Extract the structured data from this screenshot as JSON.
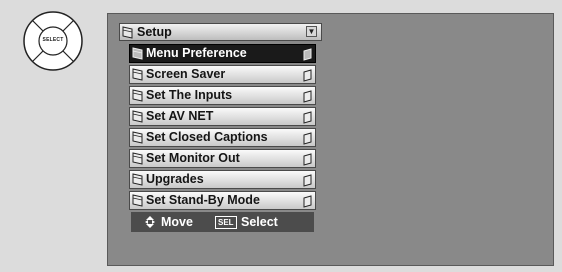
{
  "remote": {
    "center_label": "SELECT"
  },
  "menu": {
    "title": "Setup",
    "items": [
      {
        "label": "Menu Preference",
        "selected": true
      },
      {
        "label": "Screen Saver",
        "selected": false
      },
      {
        "label": "Set The Inputs",
        "selected": false
      },
      {
        "label": "Set AV NET",
        "selected": false
      },
      {
        "label": "Set Closed Captions",
        "selected": false
      },
      {
        "label": "Set Monitor Out",
        "selected": false
      },
      {
        "label": "Upgrades",
        "selected": false
      },
      {
        "label": "Set Stand-By Mode",
        "selected": false
      }
    ]
  },
  "footer": {
    "move_label": "Move",
    "sel_key": "SEL",
    "select_label": "Select"
  },
  "colors": {
    "screen_background": "#898989",
    "selected_item": "#1a1a1a",
    "footer_background": "#4c4c4c"
  }
}
